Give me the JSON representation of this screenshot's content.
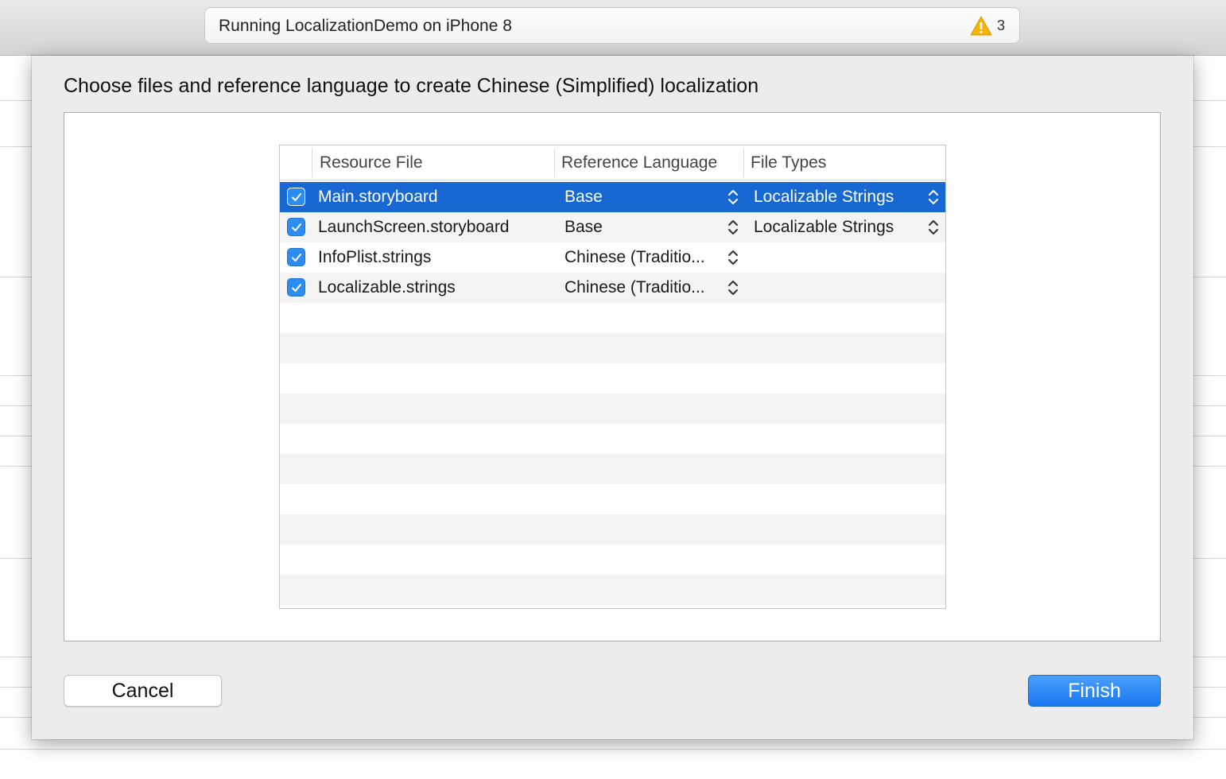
{
  "toolbar": {
    "activity_title": "Running LocalizationDemo on iPhone 8",
    "warning_icon": "warning-triangle-icon",
    "warning_count": "3",
    "warning_color": "#f5b400"
  },
  "sheet": {
    "title": "Choose files and reference language to create Chinese (Simplified) localization",
    "table": {
      "columns": [
        "Resource File",
        "Reference Language",
        "File Types"
      ],
      "rows": [
        {
          "checked": true,
          "file": "Main.storyboard",
          "language": "Base",
          "file_type": "Localizable Strings",
          "selected": true
        },
        {
          "checked": true,
          "file": "LaunchScreen.storyboard",
          "language": "Base",
          "file_type": "Localizable Strings",
          "selected": false
        },
        {
          "checked": true,
          "file": "InfoPlist.strings",
          "language": "Chinese (Traditio...",
          "file_type": "",
          "selected": false
        },
        {
          "checked": true,
          "file": "Localizable.strings",
          "language": "Chinese (Traditio...",
          "file_type": "",
          "selected": false
        }
      ]
    },
    "cancel_label": "Cancel",
    "finish_label": "Finish"
  },
  "colors": {
    "selection": "#1868d3",
    "checkbox": "#2d8cf0",
    "finish_button": "#1a77f0"
  }
}
